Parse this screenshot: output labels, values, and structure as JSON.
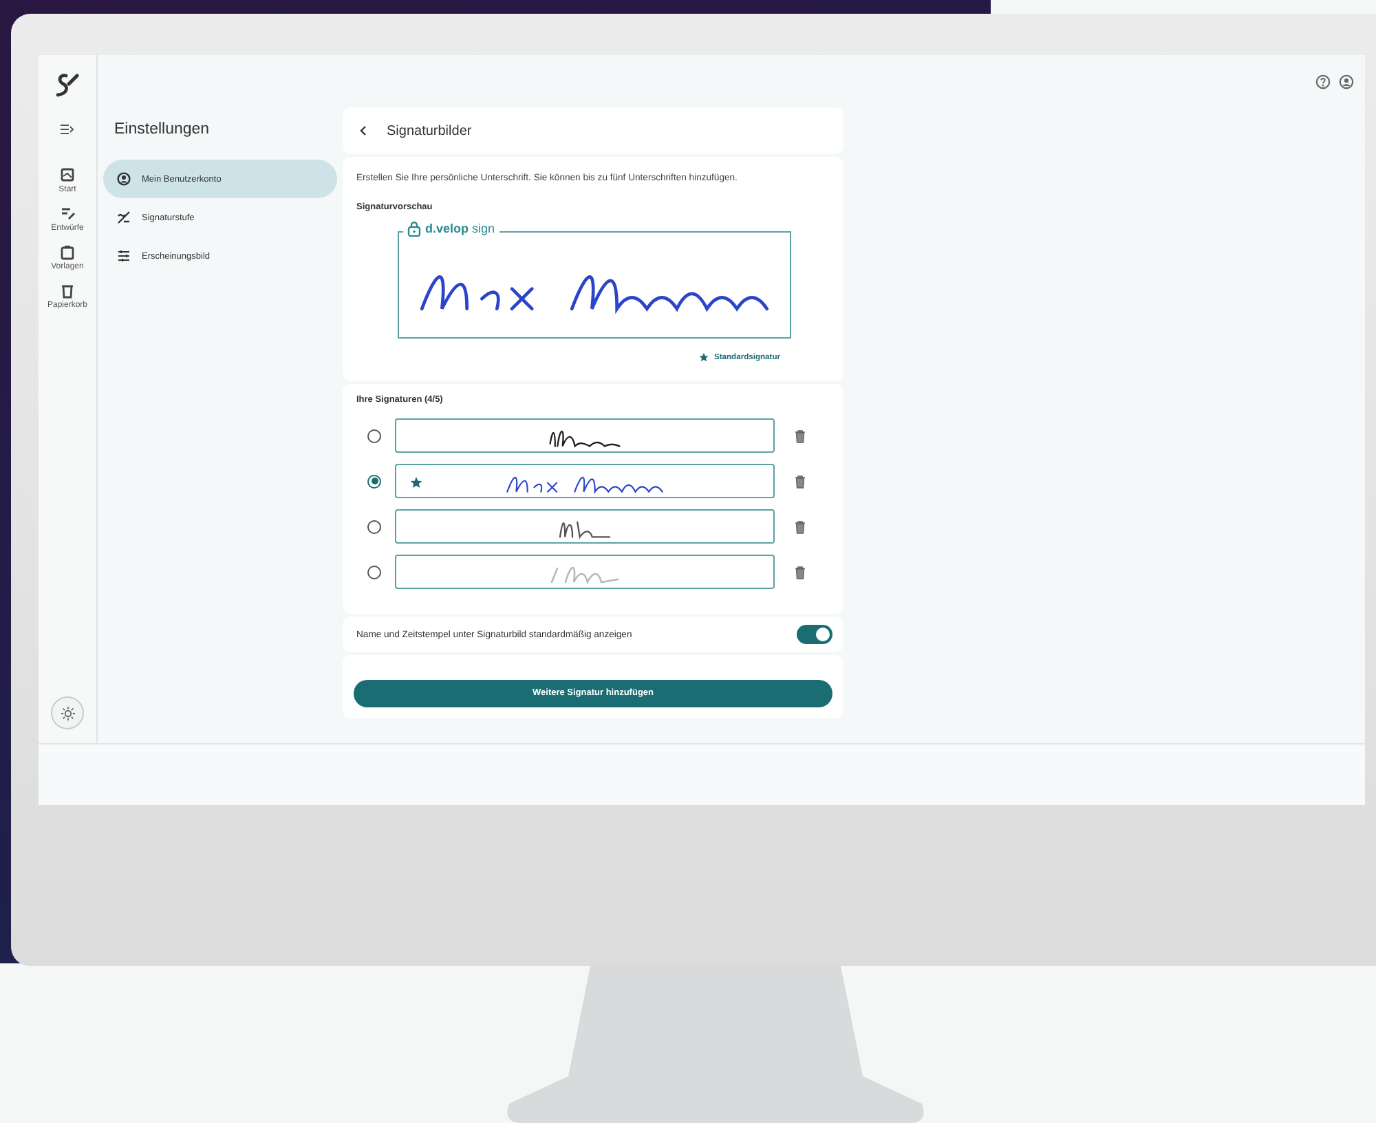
{
  "nav_rail": [
    {
      "label": "Start"
    },
    {
      "label": "Entwürfe"
    },
    {
      "label": "Vorlagen"
    },
    {
      "label": "Papierkorb"
    }
  ],
  "settings": {
    "title": "Einstellungen",
    "items": [
      {
        "label": "Mein Benutzerkonto",
        "selected": true
      },
      {
        "label": "Signaturstufe",
        "selected": false
      },
      {
        "label": "Erscheinungsbild",
        "selected": false
      }
    ]
  },
  "card": {
    "title": "Signaturbilder",
    "intro": "Erstellen Sie Ihre persönliche Unterschrift. Sie können bis zu fünf Unterschriften hinzufügen.",
    "preview_label": "Signaturvorschau",
    "preview_brand": "**d.velop** sign",
    "default_label": "Standardsignatur",
    "signatures_heading": "Ihre Signaturen (4/5)",
    "signatures": [
      {
        "selected": false,
        "default": false
      },
      {
        "selected": true,
        "default": true
      },
      {
        "selected": false,
        "default": false
      },
      {
        "selected": false,
        "default": false
      }
    ],
    "timestamp_toggle": {
      "label": "Name und Zeitstempel unter Signaturbild standardmäßig anzeigen",
      "on": true
    },
    "add_button": "Weitere Signatur hinzufügen"
  }
}
